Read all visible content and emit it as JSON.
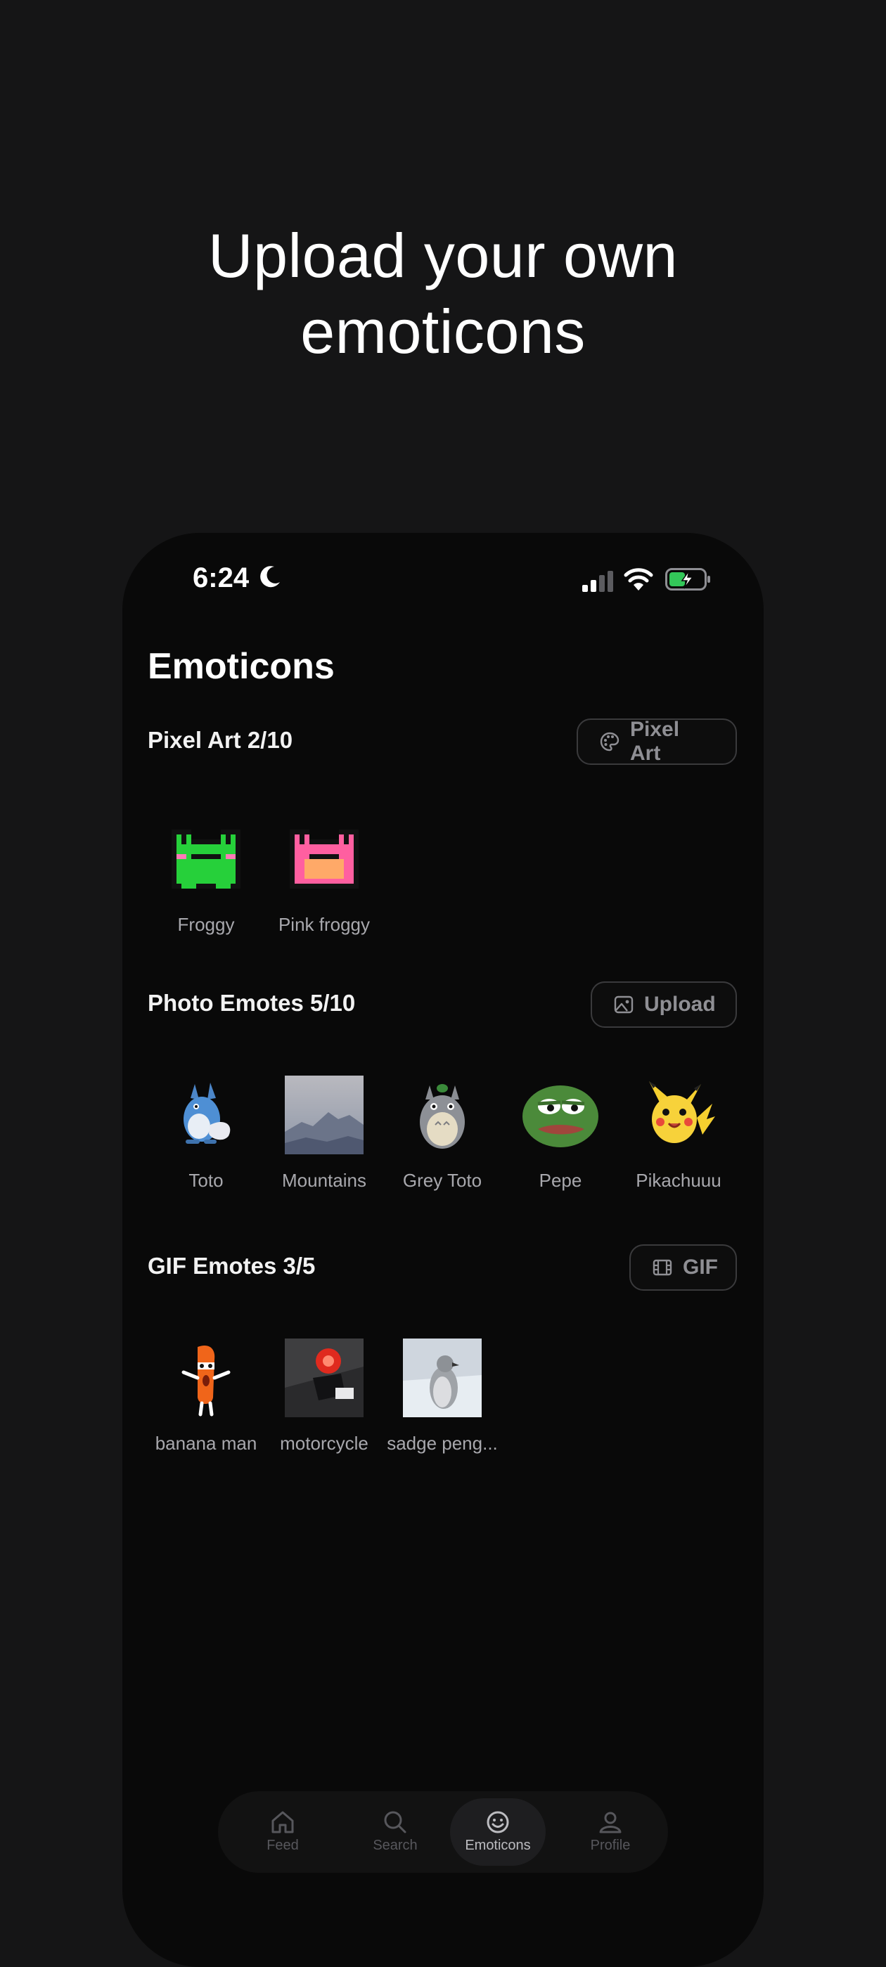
{
  "headline": {
    "line1": "Upload your own",
    "line2": "emoticons"
  },
  "status_bar": {
    "time": "6:24",
    "moon_icon": "moon-icon",
    "signal_icon": "signal-icon",
    "wifi_icon": "wifi-icon",
    "battery_icon": "battery-charging-icon"
  },
  "page": {
    "title": "Emoticons"
  },
  "sections": {
    "pixel_art": {
      "title": "Pixel Art 2/10",
      "button_label": "Pixel Art",
      "button_icon": "palette-icon",
      "items": [
        {
          "label": "Froggy",
          "color": "#22c232"
        },
        {
          "label": "Pink froggy",
          "color": "#ff6fa8"
        }
      ]
    },
    "photo": {
      "title": "Photo Emotes 5/10",
      "button_label": "Upload",
      "button_icon": "image-icon",
      "items": [
        {
          "label": "Toto"
        },
        {
          "label": "Mountains"
        },
        {
          "label": "Grey Toto"
        },
        {
          "label": "Pepe"
        },
        {
          "label": "Pikachuuu"
        }
      ]
    },
    "gif": {
      "title": "GIF Emotes 3/5",
      "button_label": "GIF",
      "button_icon": "film-icon",
      "items": [
        {
          "label": "banana man"
        },
        {
          "label": "motorcycle"
        },
        {
          "label": "sadge peng..."
        }
      ]
    }
  },
  "tabbar": {
    "tabs": [
      {
        "label": "Feed",
        "icon": "home-icon"
      },
      {
        "label": "Search",
        "icon": "search-icon"
      },
      {
        "label": "Emoticons",
        "icon": "smiley-icon",
        "active": true
      },
      {
        "label": "Profile",
        "icon": "user-icon"
      }
    ]
  },
  "colors": {
    "background": "#151516",
    "phone": "#090909",
    "accent_active_tab": "#1e1e20"
  }
}
